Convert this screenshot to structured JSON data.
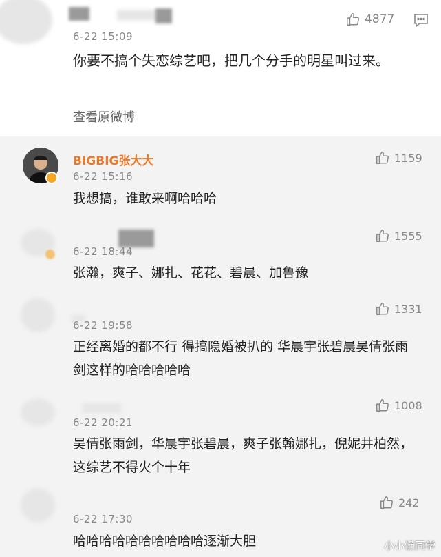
{
  "top_comment": {
    "time": "6-22 15:09",
    "text": "你要不搞个失恋综艺吧，把几个分手的明星叫过来。",
    "likes": "4877",
    "view_original": "查看原微博"
  },
  "replies": [
    {
      "name": "BIGBIG张大大",
      "time": "6-22 15:16",
      "text": "我想搞，谁敢来啊哈哈哈",
      "likes": "1159"
    },
    {
      "time": "6-22 18:44",
      "text": "张瀚，爽子、娜扎、花花、碧晨、加鲁豫",
      "likes": "1555"
    },
    {
      "time": "6-22 19:58",
      "text": "正经离婚的都不行 得搞隐婚被扒的 华晨宇张碧晨吴倩张雨剑这样的哈哈哈哈哈",
      "likes": "1331"
    },
    {
      "time": "6-22 20:21",
      "text": "吴倩张雨剑，华晨宇张碧晨，爽子张翰娜扎，倪妮井柏然，这综艺不得火个十年",
      "likes": "1008"
    },
    {
      "time": "6-22 17:30",
      "text": "哈哈哈哈哈哈哈哈哈哈逐渐大胆",
      "likes": "242"
    }
  ],
  "watermark": "小小懂同学",
  "icons": {
    "like": "thumbs-up-icon",
    "comment": "comment-icon",
    "verified": "verified-badge-icon"
  },
  "colors": {
    "accent_name": "#e8792b",
    "meta": "#888888",
    "thread_bg": "#f3f3f3"
  }
}
